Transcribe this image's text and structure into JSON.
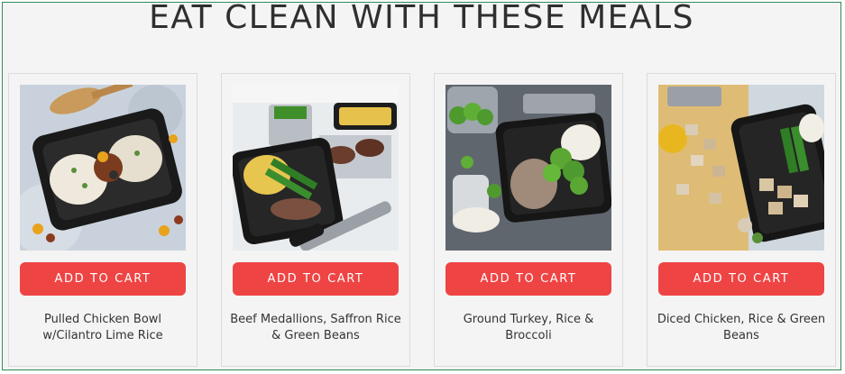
{
  "section": {
    "heading": "EAT CLEAN WITH THESE MEALS"
  },
  "products": [
    {
      "name": "Pulled Chicken Bowl w/Cilantro Lime Rice",
      "button_label": "ADD TO CART",
      "image_icon": "chicken-bowl-image"
    },
    {
      "name": "Beef Medallions, Saffron Rice & Green Beans",
      "button_label": "ADD TO CART",
      "image_icon": "beef-medallions-image"
    },
    {
      "name": "Ground Turkey, Rice & Broccoli",
      "button_label": "ADD TO CART",
      "image_icon": "ground-turkey-image"
    },
    {
      "name": "Diced Chicken, Rice & Green Beans",
      "button_label": "ADD TO CART",
      "image_icon": "diced-chicken-image"
    }
  ],
  "colors": {
    "button": "#ef4444",
    "heading": "#2f2f2f",
    "background": "#f4f4f4"
  }
}
